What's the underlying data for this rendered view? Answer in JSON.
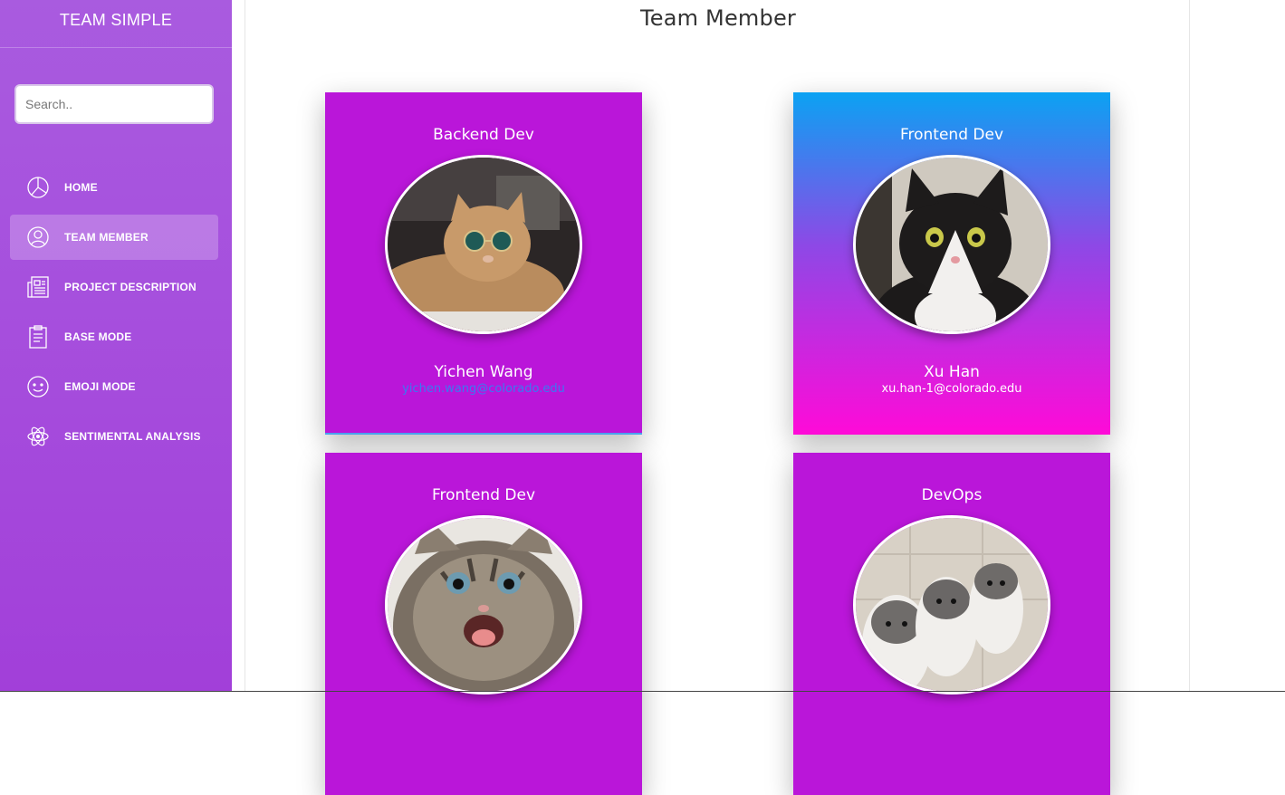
{
  "app": {
    "brand": "TEAM SIMPLE"
  },
  "search": {
    "placeholder": "Search.."
  },
  "nav": [
    {
      "label": "HOME",
      "icon": "pie-chart-icon"
    },
    {
      "label": "TEAM MEMBER",
      "icon": "user-icon",
      "active": true
    },
    {
      "label": "PROJECT DESCRIPTION",
      "icon": "newspaper-icon"
    },
    {
      "label": "BASE MODE",
      "icon": "clipboard-icon"
    },
    {
      "label": "EMOJI MODE",
      "icon": "smiley-icon"
    },
    {
      "label": "SENTIMENTAL ANALYSIS",
      "icon": "atom-icon"
    }
  ],
  "page": {
    "title": "Team Member"
  },
  "members": [
    {
      "role": "Backend Dev",
      "name": "Yichen Wang",
      "email": "yichen.wang@colorado.edu",
      "photo": "cat-with-sunglasses"
    },
    {
      "role": "Frontend Dev",
      "name": "Xu Han",
      "email": "xu.han-1@colorado.edu",
      "photo": "black-and-white-cat"
    },
    {
      "role": "Frontend Dev",
      "photo": "tabby-kitten"
    },
    {
      "role": "DevOps",
      "photo": "three-kittens"
    }
  ],
  "colors": {
    "sidebar": "#a64fdd",
    "card_purple": "#ba16d9",
    "card_gradient_top": "#0ba2f3",
    "card_gradient_bottom": "#ff0ad8",
    "email_link": "#3c78f2"
  }
}
